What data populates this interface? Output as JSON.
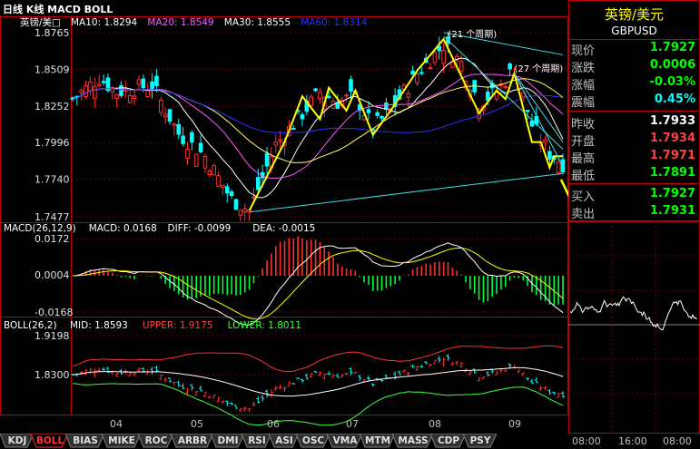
{
  "header": {
    "title": "日线 K线 MACD BOLL"
  },
  "main_panel": {
    "legend": [
      {
        "text": "英镑/美□",
        "color": "#ffffff"
      },
      {
        "text": "MA10: 1.8294",
        "color": "#ffffff"
      },
      {
        "text": "MA20: 1.8549",
        "color": "#ff55ff"
      },
      {
        "text": "MA30: 1.8555",
        "color": "#ffffff"
      },
      {
        "text": "MA60: 1.8314",
        "color": "#3030ff"
      }
    ],
    "y_ticks": [
      "1.8765",
      "1.8509",
      "1.8252",
      "1.7996",
      "1.7740",
      "1.7477"
    ],
    "annotations": [
      "(21 个周期)",
      "(27 个周期)"
    ]
  },
  "macd_panel": {
    "legend": [
      {
        "text": "MACD(26,12,9)",
        "color": "#ffffff"
      },
      {
        "text": "MACD: 0.0168",
        "color": "#ffffff"
      },
      {
        "text": "DIFF: -0.0099",
        "color": "#ffffff"
      },
      {
        "text": "DEA: -0.0015",
        "color": "#ffffff"
      }
    ],
    "y_ticks": [
      "0.0172",
      "0.0004",
      "-0.0168"
    ]
  },
  "boll_panel": {
    "legend": [
      {
        "text": "BOLL(26,2)",
        "color": "#ffffff"
      },
      {
        "text": "MID: 1.8593",
        "color": "#ffffff"
      },
      {
        "text": "UPPER: 1.9175",
        "color": "#ff4040"
      },
      {
        "text": "LOWER: 1.8011",
        "color": "#40ff40"
      }
    ],
    "y_ticks": [
      "1.9198",
      "1.8300"
    ]
  },
  "x_axis": [
    "04",
    "05",
    "06",
    "07",
    "08",
    "09"
  ],
  "quote": {
    "title": "英镑/美元",
    "code": "GBPUSD",
    "rows": [
      {
        "label": "现价",
        "value": "1.7927",
        "color": "#00ff00"
      },
      {
        "label": "涨跌",
        "value": "0.0006",
        "color": "#00ff00"
      },
      {
        "label": "涨幅",
        "value": "-0.03%",
        "color": "#00ff00"
      },
      {
        "label": "震幅",
        "value": "0.45%",
        "color": "#00ffff"
      },
      {
        "label": "昨收",
        "value": "1.7933",
        "color": "#ffffff"
      },
      {
        "label": "开盘",
        "value": "1.7934",
        "color": "#ff4040"
      },
      {
        "label": "最高",
        "value": "1.7971",
        "color": "#ff4040"
      },
      {
        "label": "最低",
        "value": "1.7891",
        "color": "#00ff00"
      },
      {
        "label": "买入",
        "value": "1.7927",
        "color": "#00ff00"
      },
      {
        "label": "卖出",
        "value": "1.7931",
        "color": "#00ff00"
      }
    ]
  },
  "tabs": [
    "KDJ",
    "BOLL",
    "BIAS",
    "MIKE",
    "ROC",
    "ARBR",
    "DMI",
    "RSI",
    "ASI",
    "OSC",
    "VMA",
    "MTM",
    "MASS",
    "CDP",
    "PSY"
  ],
  "active_tab": "BOLL",
  "intraday": {
    "times": [
      "08:00",
      "16:00",
      "08:00"
    ]
  }
}
